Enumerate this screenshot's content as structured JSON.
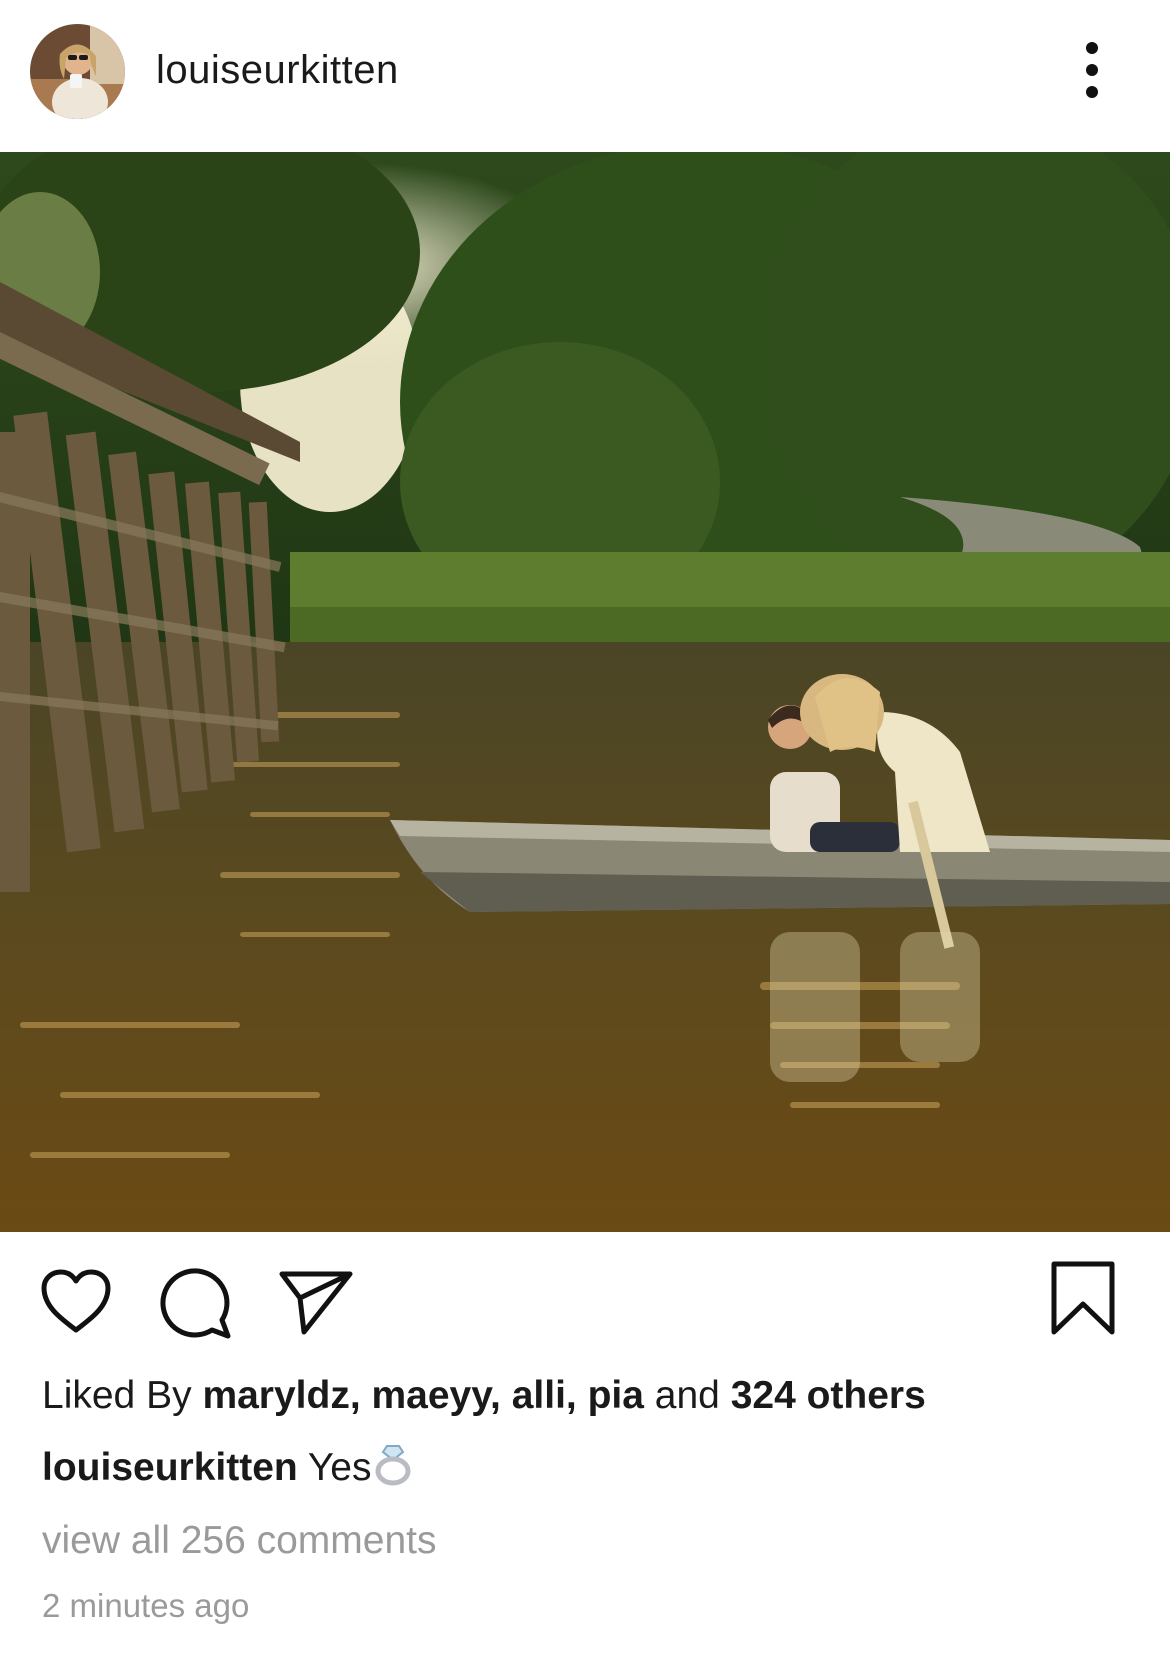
{
  "post": {
    "username": "louiseurkitten",
    "caption_user": "louiseurkitten",
    "caption_text": "Yes",
    "caption_emoji": "ring-icon",
    "likes_prefix": "Liked By",
    "liked_users": "maryldz, maeyy, alli, pia",
    "likes_joiner": "and",
    "likes_others": "324 others",
    "view_comments": "view all 256 comments",
    "timestamp": "2 minutes ago"
  },
  "icons": {
    "more": "more-options-icon",
    "like": "heart-icon",
    "comment": "comment-icon",
    "share": "send-icon",
    "save": "bookmark-icon"
  },
  "colors": {
    "text": "#1a1a1a",
    "muted": "#9a9a9a",
    "background": "#ffffff"
  }
}
